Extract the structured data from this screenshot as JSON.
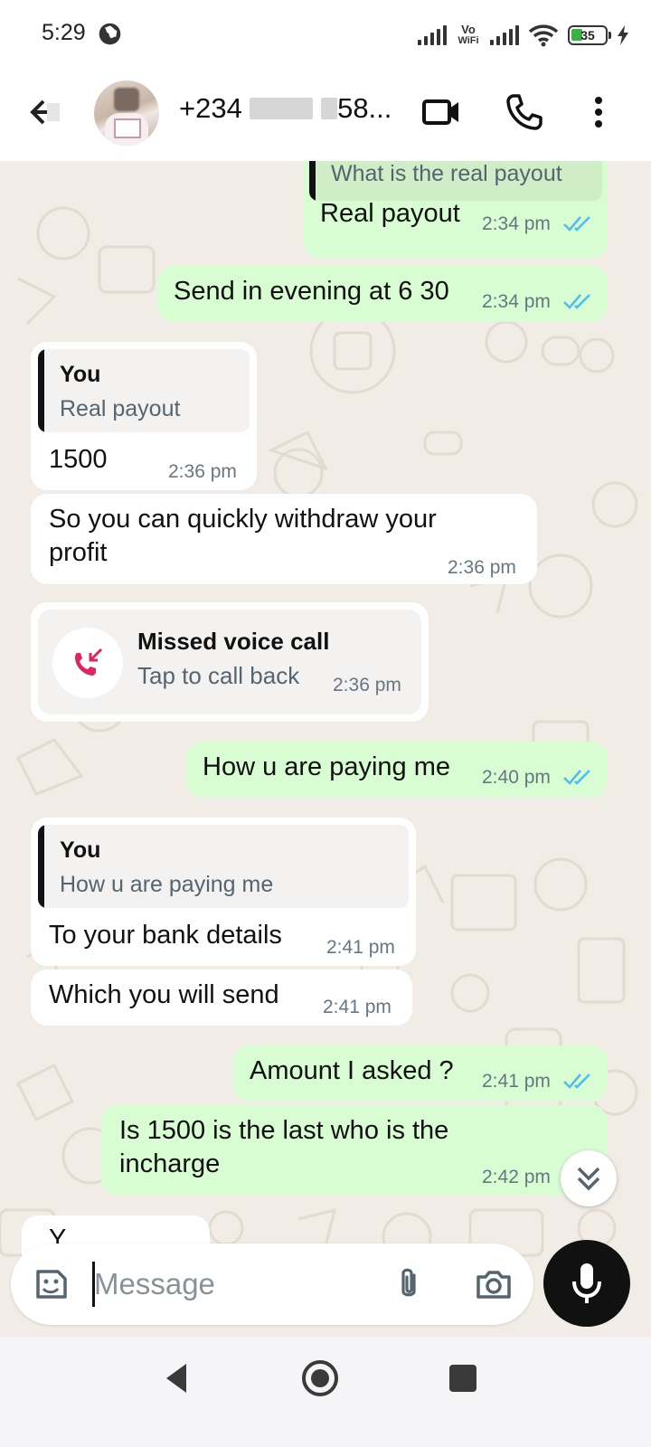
{
  "status_bar": {
    "time": "5:29",
    "vowifi_top": "Vo",
    "vowifi_bottom": "WiFi",
    "battery": "35"
  },
  "header": {
    "contact_prefix": "+234",
    "contact_suffix": "58..."
  },
  "messages": [
    {
      "id": "m1",
      "direction": "out",
      "quote_text": "What is the real payout",
      "text": "Real payout",
      "time": "2:34 pm",
      "read": true
    },
    {
      "id": "m2",
      "direction": "out",
      "text": "Send in evening at 6 30",
      "time": "2:34 pm",
      "read": true
    },
    {
      "id": "m3",
      "direction": "in",
      "quote_name": "You",
      "quote_text": "Real payout",
      "text": "1500",
      "time": "2:36 pm"
    },
    {
      "id": "m4",
      "direction": "in",
      "text_line1": "So you can quickly withdraw your",
      "text_line2": "profit",
      "time": "2:36 pm"
    },
    {
      "id": "m5",
      "direction": "in",
      "type": "missed_call",
      "title": "Missed voice call",
      "subtitle": "Tap to call back",
      "time": "2:36 pm"
    },
    {
      "id": "m6",
      "direction": "out",
      "text": "How u are paying me",
      "time": "2:40 pm",
      "read": true
    },
    {
      "id": "m7",
      "direction": "in",
      "quote_name": "You",
      "quote_text": "How u are paying me",
      "text": "To your bank details",
      "time": "2:41 pm"
    },
    {
      "id": "m8",
      "direction": "in",
      "text": "Which you will send",
      "time": "2:41 pm"
    },
    {
      "id": "m9",
      "direction": "out",
      "text": "Amount I asked ?",
      "time": "2:41 pm",
      "read": true
    },
    {
      "id": "m10",
      "direction": "out",
      "text_line1": "Is 1500 is the last who is the",
      "text_line2": "incharge",
      "time": "2:42 pm"
    },
    {
      "id": "m11",
      "direction": "in",
      "partial_text": "Y"
    }
  ],
  "composer": {
    "placeholder": "Message"
  },
  "colors": {
    "outgoing_bubble": "#d9fdd3",
    "incoming_bubble": "#ffffff",
    "chat_background": "#f1ece5",
    "read_tick": "#53bdeb",
    "missed_call": "#e0245e"
  },
  "icons": [
    "back-arrow-icon",
    "video-call-icon",
    "voice-call-icon",
    "more-options-icon",
    "sticker-icon",
    "attach-icon",
    "camera-icon",
    "mic-icon",
    "scroll-down-icon",
    "missed-call-icon"
  ]
}
